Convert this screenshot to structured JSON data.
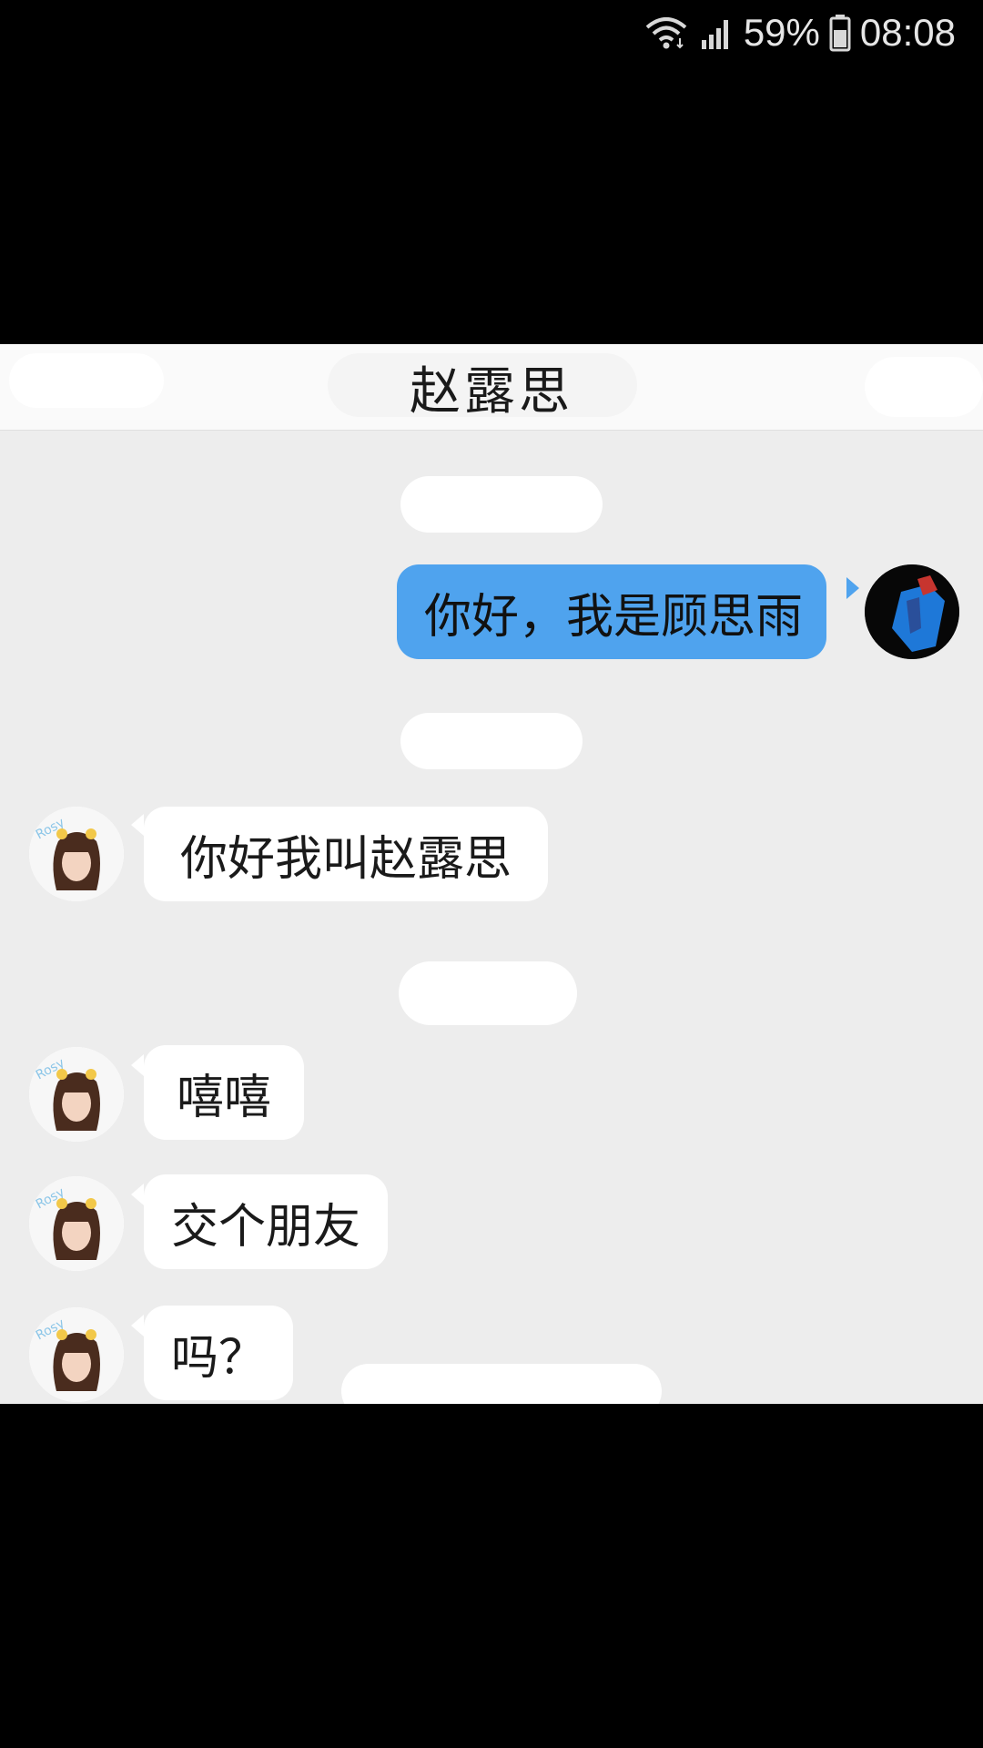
{
  "status_bar": {
    "battery": "59%",
    "time": "08:08",
    "icons": [
      "wifi-icon",
      "cellular-signal-icon",
      "battery-icon"
    ]
  },
  "chat": {
    "title": "赵露思",
    "messages": [
      {
        "side": "out",
        "text": "你好，我是顾思雨",
        "avatar": "my-avatar"
      },
      {
        "side": "in",
        "text": "你好我叫赵露思",
        "avatar": "contact-avatar"
      },
      {
        "side": "in",
        "text": "嘻嘻",
        "avatar": "contact-avatar"
      },
      {
        "side": "in",
        "text": "交个朋友",
        "avatar": "contact-avatar"
      },
      {
        "side": "in",
        "text": "吗？",
        "avatar": "contact-avatar"
      }
    ]
  },
  "colors": {
    "outgoing_bubble": "#4fa3ee",
    "incoming_bubble": "#ffffff",
    "chat_background": "#ededed"
  }
}
